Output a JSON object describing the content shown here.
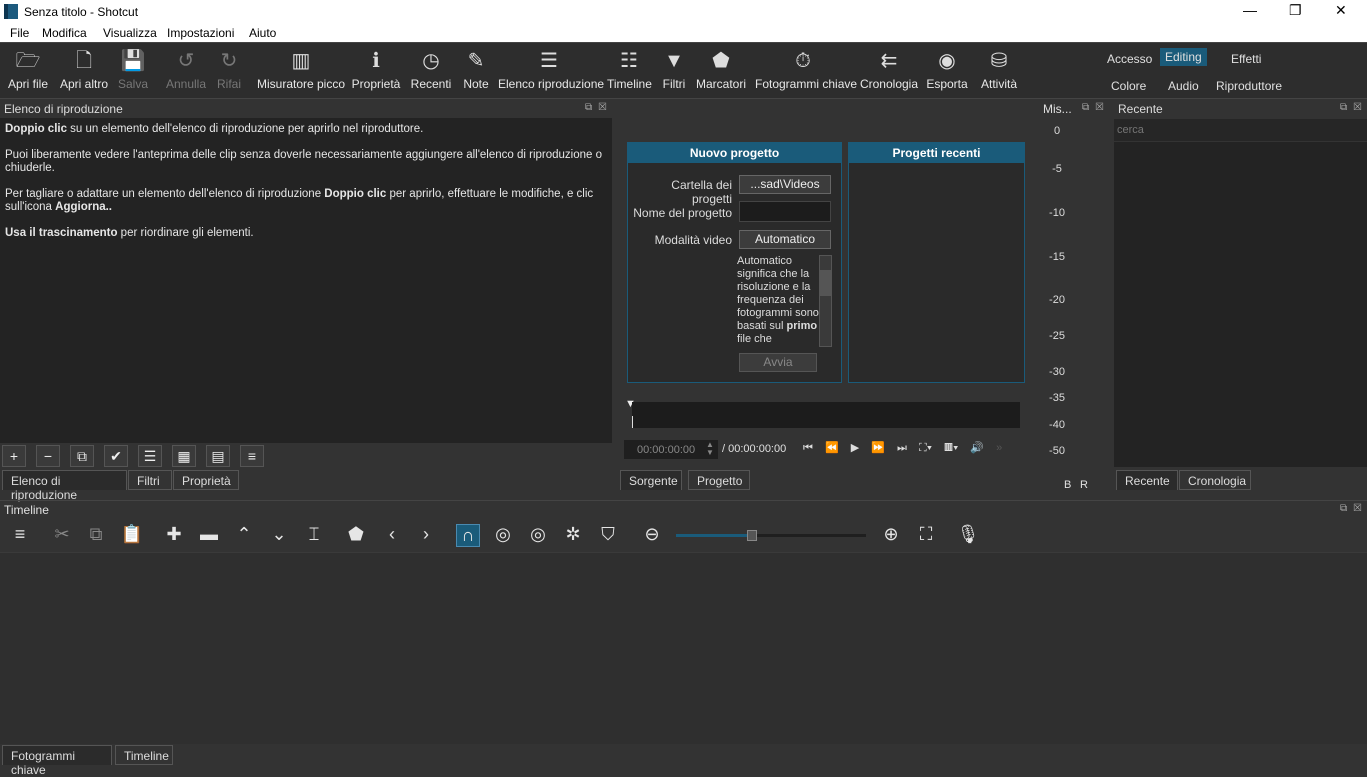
{
  "window": {
    "title": "Senza titolo - Shotcut"
  },
  "menu": [
    "File",
    "Modifica",
    "Visualizza",
    "Impostazioni",
    "Aiuto"
  ],
  "toolbar": [
    {
      "label": "Apri file",
      "icon": "folder-open-icon",
      "glyph": "🗁",
      "enabled": true
    },
    {
      "label": "Apri altro",
      "icon": "file-add-icon",
      "glyph": "🗋",
      "enabled": true
    },
    {
      "label": "Salva",
      "icon": "save-icon",
      "glyph": "💾",
      "enabled": false
    },
    {
      "label": "Annulla",
      "icon": "undo-icon",
      "glyph": "↺",
      "enabled": false
    },
    {
      "label": "Rifai",
      "icon": "redo-icon",
      "glyph": "↻",
      "enabled": false
    },
    {
      "label": "Misuratore picco",
      "icon": "peak-meter-icon",
      "glyph": "▥",
      "enabled": true
    },
    {
      "label": "Proprietà",
      "icon": "info-icon",
      "glyph": "ℹ",
      "enabled": true
    },
    {
      "label": "Recenti",
      "icon": "clock-icon",
      "glyph": "◷",
      "enabled": true
    },
    {
      "label": "Note",
      "icon": "note-edit-icon",
      "glyph": "✎",
      "enabled": true
    },
    {
      "label": "Elenco riproduzione",
      "icon": "list-icon",
      "glyph": "☰",
      "enabled": true
    },
    {
      "label": "Timeline",
      "icon": "timeline-icon",
      "glyph": "☷",
      "enabled": true
    },
    {
      "label": "Filtri",
      "icon": "filter-icon",
      "glyph": "▼",
      "enabled": true
    },
    {
      "label": "Marcatori",
      "icon": "marker-icon",
      "glyph": "⬟",
      "enabled": true
    },
    {
      "label": "Fotogrammi chiave",
      "icon": "stopwatch-icon",
      "glyph": "⏱",
      "enabled": true
    },
    {
      "label": "Cronologia",
      "icon": "history-icon",
      "glyph": "⇇",
      "enabled": true
    },
    {
      "label": "Esporta",
      "icon": "disc-icon",
      "glyph": "◉",
      "enabled": true
    },
    {
      "label": "Attività",
      "icon": "database-icon",
      "glyph": "⛁",
      "enabled": true
    }
  ],
  "layouts": {
    "row1": [
      "Accesso",
      "Editing",
      "Effetti"
    ],
    "row2": [
      "Colore",
      "Audio",
      "Riproduttore"
    ],
    "selected": "Editing"
  },
  "playlist": {
    "title": "Elenco di riproduzione",
    "help": [
      [
        {
          "b": true,
          "t": "Doppio clic"
        },
        {
          "b": false,
          "t": " su un elemento dell'elenco di riproduzione per aprirlo nel riproduttore."
        }
      ],
      [
        {
          "b": false,
          "t": "Puoi liberamente vedere l'anteprima delle clip senza doverle necessariamente aggiungere all'elenco di riproduzione o chiuderle."
        }
      ],
      [
        {
          "b": false,
          "t": "Per tagliare o adattare un elemento dell'elenco di riproduzione "
        },
        {
          "b": true,
          "t": "Doppio clic"
        },
        {
          "b": false,
          "t": " per aprirlo, effettuare le modifiche, e clic sull'icona "
        },
        {
          "b": true,
          "t": "Aggiorna.."
        }
      ],
      [
        {
          "b": true,
          "t": "Usa il trascinamento"
        },
        {
          "b": false,
          "t": " per riordinare gli elementi."
        }
      ]
    ],
    "buttons": [
      {
        "icon": "plus-icon",
        "g": "+"
      },
      {
        "icon": "minus-icon",
        "g": "−"
      },
      {
        "icon": "update-icon",
        "g": "⧉"
      },
      {
        "icon": "check-icon",
        "g": "✔"
      },
      {
        "icon": "details-view-icon",
        "g": "☰"
      },
      {
        "icon": "tiles-view-icon",
        "g": "▦"
      },
      {
        "icon": "icons-view-icon",
        "g": "▤"
      },
      {
        "icon": "menu-icon",
        "g": "≡"
      }
    ],
    "tabs": [
      "Elenco di riproduzione",
      "Filtri",
      "Proprietà"
    ]
  },
  "player": {
    "new_project": {
      "title": "Nuovo progetto",
      "folder_label": "Cartella dei progetti",
      "folder_value": "...sad\\Videos",
      "name_label": "Nome del progetto",
      "name_value": "",
      "mode_label": "Modalità video",
      "mode_value": "Automatico",
      "desc_pre": "Automatico significa che la risoluzione e la frequenza dei fotogrammi sono basati sul ",
      "desc_bold": "primo",
      "desc_post": " file che",
      "start": "Avvia"
    },
    "recent_projects": {
      "title": "Progetti recenti"
    },
    "position": "00:00:00:00",
    "duration": "/ 00:00:00:00",
    "tabs": [
      "Sorgente",
      "Progetto"
    ]
  },
  "meter": {
    "title": "Mis...",
    "labels": [
      "0",
      "-5",
      "-10",
      "-15",
      "-20",
      "-25",
      "-30",
      "-35",
      "-40",
      "-50"
    ],
    "channels": [
      "B",
      "R"
    ]
  },
  "recent": {
    "title": "Recente",
    "search_placeholder": "cerca",
    "tabs": [
      "Recente",
      "Cronologia"
    ]
  },
  "timeline": {
    "title": "Timeline",
    "zoom_level": 0.4,
    "tools": [
      {
        "icon": "menu-icon",
        "g": "≡"
      },
      {
        "icon": "cut-icon",
        "g": "✂"
      },
      {
        "icon": "copy-icon",
        "g": "⧉"
      },
      {
        "icon": "paste-icon",
        "g": "📋"
      },
      {
        "icon": "append-icon",
        "g": "✚"
      },
      {
        "icon": "remove-icon",
        "g": "▬"
      },
      {
        "icon": "lift-icon",
        "g": "⌃"
      },
      {
        "icon": "overwrite-icon",
        "g": "⌄"
      },
      {
        "icon": "split-icon",
        "g": "⌶"
      },
      {
        "icon": "marker-icon",
        "g": "⬟"
      },
      {
        "icon": "prev-marker-icon",
        "g": "‹"
      },
      {
        "icon": "next-marker-icon",
        "g": "›"
      },
      {
        "icon": "snap-icon",
        "g": "∩"
      },
      {
        "icon": "scrub-icon",
        "g": "◎"
      },
      {
        "icon": "ripple-icon",
        "g": "◎"
      },
      {
        "icon": "ripple-all-icon",
        "g": "✲"
      },
      {
        "icon": "ripple-markers-icon",
        "g": "⛉"
      }
    ],
    "tabs": [
      "Fotogrammi chiave",
      "Timeline"
    ]
  },
  "colors": {
    "accent": "#1a5b7a"
  }
}
